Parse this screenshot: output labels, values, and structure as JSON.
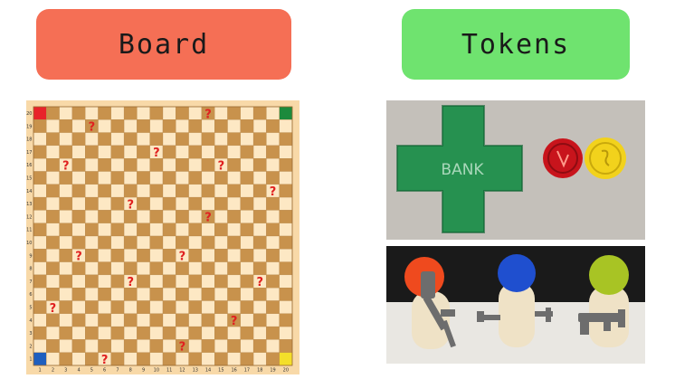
{
  "headers": {
    "board": {
      "label": "Board",
      "color": "#f56f55"
    },
    "tokens": {
      "label": "Tokens",
      "color": "#6fe36f"
    }
  },
  "board": {
    "size": 20,
    "colors": {
      "light": "#fde8c4",
      "dark": "#c8924c",
      "frame": "#f8d9a8",
      "question": "#e02020",
      "corner_top_left": "#e8232a",
      "corner_top_right": "#1c8a3c",
      "corner_bottom_left": "#1f5fbf",
      "corner_bottom_right": "#f4df2a"
    },
    "row_labels": [
      "20",
      "19",
      "18",
      "17",
      "16",
      "15",
      "14",
      "13",
      "12",
      "11",
      "10",
      "9",
      "8",
      "7",
      "6",
      "5",
      "4",
      "3",
      "2",
      "1"
    ],
    "col_labels": [
      "1",
      "2",
      "3",
      "4",
      "5",
      "6",
      "7",
      "8",
      "9",
      "10",
      "11",
      "12",
      "13",
      "14",
      "15",
      "16",
      "17",
      "18",
      "19",
      "20"
    ],
    "question_glyph": "?",
    "question_cells": [
      {
        "col": 14,
        "row": 20
      },
      {
        "col": 5,
        "row": 19
      },
      {
        "col": 10,
        "row": 17
      },
      {
        "col": 3,
        "row": 16
      },
      {
        "col": 15,
        "row": 16
      },
      {
        "col": 19,
        "row": 14
      },
      {
        "col": 8,
        "row": 13
      },
      {
        "col": 14,
        "row": 12
      },
      {
        "col": 4,
        "row": 9
      },
      {
        "col": 12,
        "row": 9
      },
      {
        "col": 8,
        "row": 7
      },
      {
        "col": 18,
        "row": 7
      },
      {
        "col": 2,
        "row": 5
      },
      {
        "col": 16,
        "row": 4
      },
      {
        "col": 12,
        "row": 2
      },
      {
        "col": 6,
        "row": 1
      }
    ]
  },
  "photos": {
    "bank": {
      "background": "#c4c0ba",
      "cross_color": "#1e8e4a",
      "cross_label": "BANK",
      "coin_red_color": "#c8141c",
      "coin_yellow_color": "#f2d21c"
    },
    "pawns": {
      "background_dark": "#1a1a1a",
      "table_color": "#e9e7e2",
      "body_color": "#efe2c6",
      "head_colors": [
        "#ef4a1e",
        "#1f4fcf",
        "#a8c424"
      ],
      "weapon_color": "#6d6d6d"
    }
  }
}
